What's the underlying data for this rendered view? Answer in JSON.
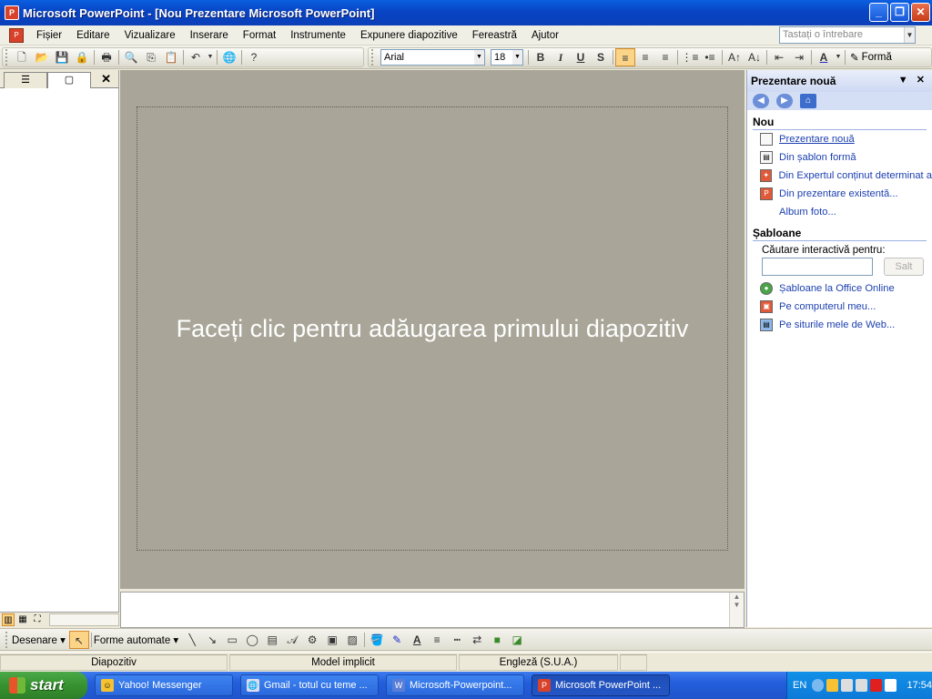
{
  "window": {
    "title": "Microsoft PowerPoint - [Nou Prezentare Microsoft PowerPoint]",
    "app_icon": "P"
  },
  "menu": {
    "items": [
      "Fișier",
      "Editare",
      "Vizualizare",
      "Inserare",
      "Format",
      "Instrumente",
      "Expunere diapozitive",
      "Fereastră",
      "Ajutor"
    ],
    "help_placeholder": "Tastați o întrebare"
  },
  "format": {
    "font": "Arial",
    "size": "18",
    "bold": "B",
    "italic": "I",
    "underline": "U",
    "shadow": "S",
    "design_label": "Formă"
  },
  "slide": {
    "placeholder_text": "Faceți clic pentru adăugarea primului diapozitiv"
  },
  "task_pane": {
    "title": "Prezentare nouă",
    "section_new": "Nou",
    "new_items": [
      {
        "label": "Prezentare nouă",
        "icon": "blank-doc-icon"
      },
      {
        "label": "Din șablon formă",
        "icon": "template-icon"
      },
      {
        "label": "Din Expertul conținut determinat a",
        "icon": "wizard-icon"
      },
      {
        "label": "Din prezentare existentă...",
        "icon": "existing-presentation-icon"
      },
      {
        "label": "Album foto..."
      }
    ],
    "section_templates": "Șabloane",
    "search_label": "Căutare interactivă pentru:",
    "search_button": "Salt",
    "template_items": [
      {
        "label": "Șabloane la Office Online",
        "icon": "globe-icon"
      },
      {
        "label": "Pe computerul meu...",
        "icon": "computer-icon"
      },
      {
        "label": "Pe siturile mele de Web...",
        "icon": "web-folder-icon"
      }
    ]
  },
  "draw_toolbar": {
    "draw_label": "Desenare",
    "autoshapes_label": "Forme automate"
  },
  "statusbar": {
    "slide": "Diapozitiv",
    "design": "Model implicit",
    "language": "Engleză (S.U.A.)"
  },
  "taskbar": {
    "start": "start",
    "tasks": [
      {
        "label": "Yahoo! Messenger"
      },
      {
        "label": "Gmail - totul cu teme ..."
      },
      {
        "label": "Microsoft-Powerpoint..."
      },
      {
        "label": "Microsoft PowerPoint ..."
      }
    ],
    "lang": "EN",
    "clock": "17:54"
  },
  "colors": {
    "slide_bg": "#a9a699",
    "title_blue": "#0a4fd0",
    "selected_align": "#fbd488"
  }
}
